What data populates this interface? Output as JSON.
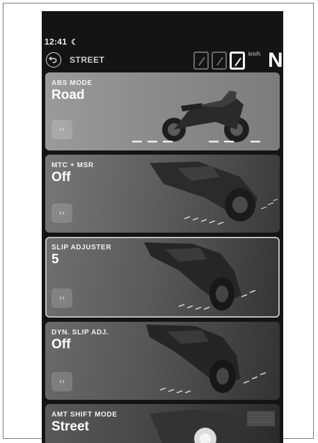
{
  "status_bar": {
    "time": "12:41",
    "icon": "moon-icon"
  },
  "header": {
    "mode_label": "STREET",
    "back_icon": "back-arrow-icon",
    "speed_unit": "km/h",
    "speed_digits": [
      "0",
      "0",
      "0"
    ],
    "gear": "N"
  },
  "cards": [
    {
      "title": "ABS MODE",
      "value": "Road"
    },
    {
      "title": "MTC + MSR",
      "value": "Off"
    },
    {
      "title": "SLIP ADJUSTER",
      "value": "5",
      "selected": true
    },
    {
      "title": "DYN. SLIP ADJ.",
      "value": "Off"
    },
    {
      "title": "AMT SHIFT MODE",
      "value": "Street"
    }
  ],
  "cycle_icon": "‹›",
  "colors": {
    "background": "#141414",
    "card_border_selected": "#bdbdbd",
    "text": "#ffffff"
  }
}
